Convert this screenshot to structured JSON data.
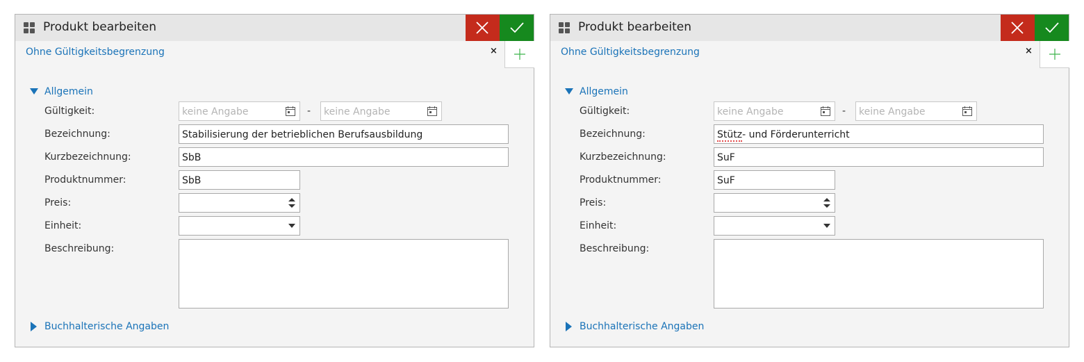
{
  "dialogs": [
    {
      "title": "Produkt bearbeiten",
      "tab_label": "Ohne Gültigkeitsbegrenzung",
      "tab_close": "×",
      "section_general": "Allgemein",
      "section_accounting": "Buchhalterische Angaben",
      "fields": {
        "validity_label": "Gültigkeit:",
        "validity_from_placeholder": "keine Angabe",
        "validity_to_placeholder": "keine Angabe",
        "validity_separator": "-",
        "name_label": "Bezeichnung:",
        "name_value": "Stabilisierung der betrieblichen Berufsausbildung",
        "short_name_label": "Kurzbezeichnung:",
        "short_name_value": "SbB",
        "product_number_label": "Produktnummer:",
        "product_number_value": "SbB",
        "price_label": "Preis:",
        "price_value": "",
        "unit_label": "Einheit:",
        "unit_value": "",
        "description_label": "Beschreibung:",
        "description_value": ""
      }
    },
    {
      "title": "Produkt bearbeiten",
      "tab_label": "Ohne Gültigkeitsbegrenzung",
      "tab_close": "×",
      "section_general": "Allgemein",
      "section_accounting": "Buchhalterische Angaben",
      "fields": {
        "validity_label": "Gültigkeit:",
        "validity_from_placeholder": "keine Angabe",
        "validity_to_placeholder": "keine Angabe",
        "validity_separator": "-",
        "name_label": "Bezeichnung:",
        "name_value_part1": "Stütz",
        "name_value_part2": "- und Förderunterricht",
        "short_name_label": "Kurzbezeichnung:",
        "short_name_value": "SuF",
        "product_number_label": "Produktnummer:",
        "product_number_value": "SuF",
        "price_label": "Preis:",
        "price_value": "",
        "unit_label": "Einheit:",
        "unit_value": "",
        "description_label": "Beschreibung:",
        "description_value": ""
      }
    }
  ],
  "colors": {
    "accent": "#1a73b8",
    "cancel": "#c42b1c",
    "confirm": "#16891e",
    "add": "#3cb44b"
  },
  "icons": [
    "apps-grid-icon",
    "close-icon",
    "checkmark-icon",
    "plus-icon",
    "calendar-icon",
    "triangle-down-icon",
    "triangle-right-icon",
    "spinner-icon",
    "chevron-down-icon"
  ]
}
